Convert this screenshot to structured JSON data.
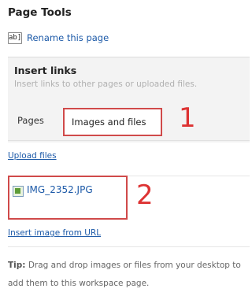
{
  "panel": {
    "title": "Page Tools",
    "rename_icon_text": "ab]",
    "rename_label": "Rename this page"
  },
  "insert_links": {
    "title": "Insert links",
    "subtitle": "Insert links to other pages or uploaded files.",
    "tabs": [
      {
        "label": "Pages"
      },
      {
        "label": "Images and files"
      }
    ]
  },
  "annotations": {
    "one": "1",
    "two": "2"
  },
  "files": {
    "upload_label": "Upload files",
    "items": [
      {
        "name": "IMG_2352.JPG",
        "icon": "image-file-icon"
      }
    ],
    "insert_url_label": "Insert image from URL"
  },
  "tip": {
    "label": "Tip:",
    "text": " Drag and drop images or files from your desktop to add them to this workspace page."
  },
  "colors": {
    "link": "#1d5aa8",
    "annotation": "#d33333",
    "panel_bg": "#f3f3f3"
  }
}
